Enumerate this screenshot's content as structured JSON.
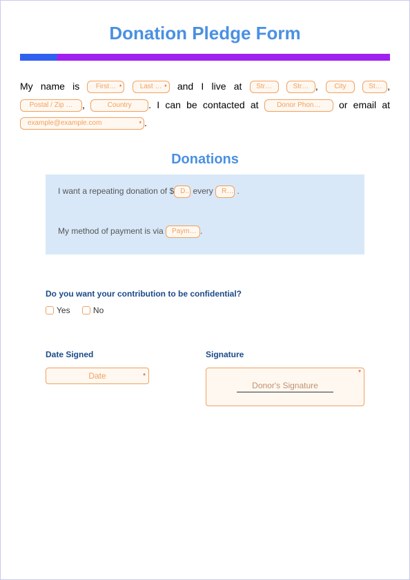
{
  "title": "Donation Pledge Form",
  "intro": {
    "t1": "My name is ",
    "first": "First…",
    "last": "Last …",
    "t2": " and I live at ",
    "street1": "Str…",
    "street2": "Str…",
    "comma": ", ",
    "city": "City",
    "state": "St…",
    "postal": "Postal / Zip …",
    "country": "Country",
    "t3": ". I can be contacted at ",
    "phone": "Donor Phon…",
    "t4": " or email at ",
    "email": "example@example.com",
    "period": "."
  },
  "donations": {
    "heading": "Donations",
    "line1a": "I want a repeating donation of $",
    "amount": "D..",
    "line1b": " every ",
    "repeat": "R…",
    "line1c": " .",
    "line2a": "My method of payment is via ",
    "method": "Paym…",
    "line2b": "."
  },
  "confidential": {
    "question": "Do you want your contribution to be confidential?",
    "yes": "Yes",
    "no": "No"
  },
  "signing": {
    "dateLabel": "Date Signed",
    "datePlaceholder": "Date",
    "sigLabel": "Signature",
    "sigPlaceholder": "Donor's Signature"
  }
}
